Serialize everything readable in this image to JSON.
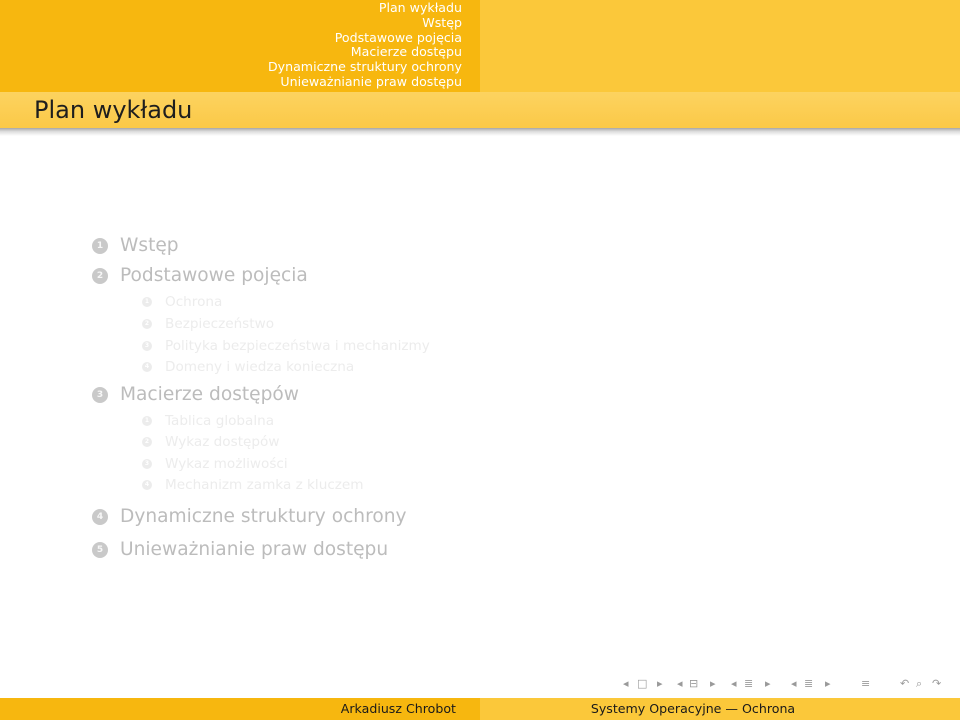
{
  "header": {
    "nav_items": [
      "Plan wykładu",
      "Wstęp",
      "Podstawowe pojęcia",
      "Macierze dostępu",
      "Dynamiczne struktury ochrony",
      "Unieważnianie praw dostępu"
    ]
  },
  "frame_title": "Plan wykładu",
  "outline": {
    "sections": [
      {
        "num": "1",
        "label": "Wstęp"
      },
      {
        "num": "2",
        "label": "Podstawowe pojęcia",
        "subsections": [
          {
            "num": "1",
            "label": "Ochrona"
          },
          {
            "num": "2",
            "label": "Bezpieczeństwo"
          },
          {
            "num": "3",
            "label": "Polityka bezpieczeństwa i mechanizmy"
          },
          {
            "num": "4",
            "label": "Domeny i wiedza konieczna"
          }
        ]
      },
      {
        "num": "3",
        "label": "Macierze dostępów",
        "subsections": [
          {
            "num": "1",
            "label": "Tablica globalna"
          },
          {
            "num": "2",
            "label": "Wykaz dostępów"
          },
          {
            "num": "3",
            "label": "Wykaz możliwości"
          },
          {
            "num": "4",
            "label": "Mechanizm zamka z kluczem"
          }
        ]
      },
      {
        "num": "4",
        "label": "Dynamiczne struktury ochrony"
      },
      {
        "num": "5",
        "label": "Unieważnianie praw dostępu"
      }
    ]
  },
  "navigation_symbols": [
    {
      "icon": "prev-frame-icon",
      "glyph": "◂"
    },
    {
      "icon": "frame-icon",
      "glyph": "□"
    },
    {
      "icon": "next-frame-icon",
      "glyph": "▸"
    },
    {
      "icon": "prev-subsection-icon",
      "glyph": "◂"
    },
    {
      "icon": "subsection-icon",
      "glyph": "⊟"
    },
    {
      "icon": "next-subsection-icon",
      "glyph": "▸"
    },
    {
      "icon": "prev-section-icon",
      "glyph": "◂"
    },
    {
      "icon": "section-icon",
      "glyph": "≣"
    },
    {
      "icon": "next-section-icon",
      "glyph": "▸"
    },
    {
      "icon": "prev-part-icon",
      "glyph": "◂"
    },
    {
      "icon": "part-icon",
      "glyph": "≣"
    },
    {
      "icon": "next-part-icon",
      "glyph": "▸"
    },
    {
      "icon": "document-icon",
      "glyph": "≡"
    },
    {
      "icon": "back-icon",
      "glyph": "↶"
    },
    {
      "icon": "search-icon",
      "glyph": "⌕"
    },
    {
      "icon": "forward-icon",
      "glyph": "↷"
    }
  ],
  "footer": {
    "author": "Arkadiusz Chrobot",
    "title": "Systemy Operacyjne — Ochrona"
  },
  "colors": {
    "header_left": "#f7b70f",
    "header_right": "#fbc83a",
    "title_bar": "#fcd360",
    "nav_text": "#ffffff",
    "section_text": "#bcbcbc",
    "subsection_text": "#ececec"
  }
}
